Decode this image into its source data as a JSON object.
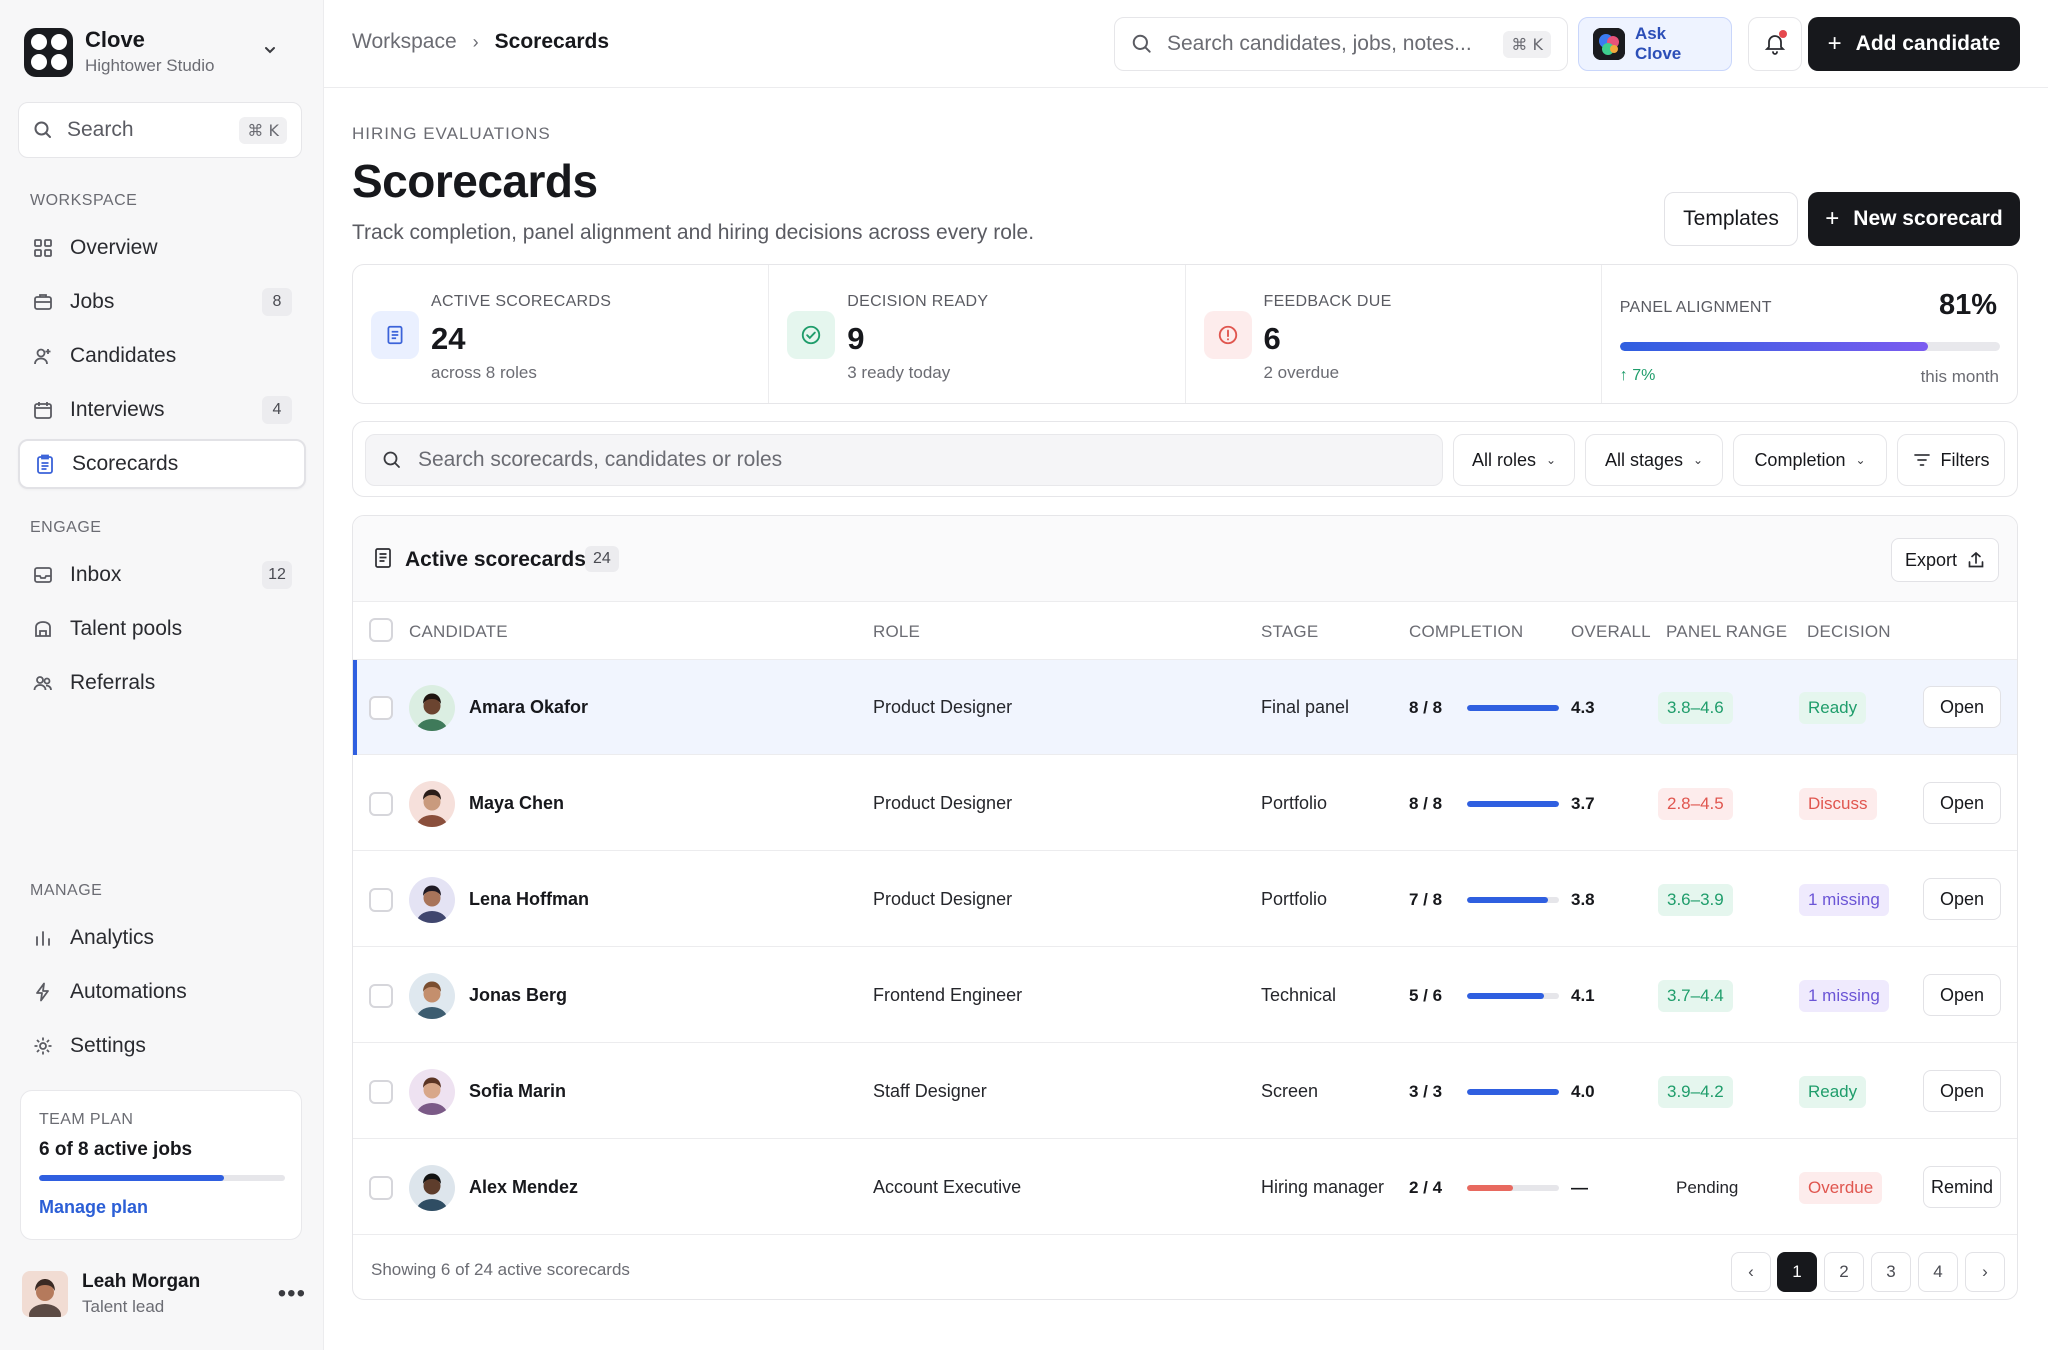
{
  "brand": {
    "name": "Clove",
    "workspace": "Hightower Studio"
  },
  "sidebar": {
    "search_placeholder": "Search",
    "search_shortcut": "⌘ K",
    "sections": {
      "workspace": "WORKSPACE",
      "engage": "ENGAGE",
      "manage": "MANAGE"
    },
    "items": [
      {
        "label": "Overview",
        "icon": "grid-icon",
        "count": null
      },
      {
        "label": "Jobs",
        "icon": "briefcase-icon",
        "count": "8"
      },
      {
        "label": "Candidates",
        "icon": "user-plus-icon",
        "count": null
      },
      {
        "label": "Interviews",
        "icon": "calendar-icon",
        "count": "4"
      },
      {
        "label": "Scorecards",
        "icon": "clipboard-icon",
        "count": null,
        "active": true
      },
      {
        "label": "Inbox",
        "icon": "inbox-icon",
        "count": "12"
      },
      {
        "label": "Talent pools",
        "icon": "bank-icon",
        "count": null
      },
      {
        "label": "Referrals",
        "icon": "users-icon",
        "count": null
      },
      {
        "label": "Analytics",
        "icon": "bar-chart-icon",
        "count": null
      },
      {
        "label": "Automations",
        "icon": "bolt-icon",
        "count": null
      },
      {
        "label": "Settings",
        "icon": "gear-icon",
        "count": null
      }
    ],
    "plan": {
      "label": "TEAM PLAN",
      "value": "6 of 8 active jobs",
      "progress": 0.75,
      "link": "Manage plan"
    },
    "user": {
      "name": "Leah Morgan",
      "role": "Talent lead"
    }
  },
  "topbar": {
    "breadcrumb": [
      "Workspace",
      "Scorecards"
    ],
    "search_placeholder": "Search candidates, jobs, notes...",
    "search_shortcut": "⌘ K",
    "ask_label": "Ask Clove",
    "add_label": "Add candidate"
  },
  "header": {
    "kicker": "HIRING EVALUATIONS",
    "title": "Scorecards",
    "subtitle": "Track completion, panel alignment and hiring decisions across every role.",
    "templates_label": "Templates",
    "new_label": "New scorecard"
  },
  "stats": [
    {
      "label": "ACTIVE SCORECARDS",
      "value": "24",
      "sub": "across 8 roles"
    },
    {
      "label": "DECISION READY",
      "value": "9",
      "sub": "3 ready today"
    },
    {
      "label": "FEEDBACK DUE",
      "value": "6",
      "sub": "2 overdue"
    }
  ],
  "alignment": {
    "label": "PANEL ALIGNMENT",
    "value": "81%",
    "progress": 0.81,
    "delta": "↑ 7%",
    "period": "this month"
  },
  "filters": {
    "search_placeholder": "Search scorecards, candidates or roles",
    "roles": "All roles",
    "stages": "All stages",
    "completion": "Completion",
    "more": "Filters"
  },
  "table": {
    "title": "Active scorecards",
    "count": "24",
    "export_label": "Export",
    "columns": {
      "candidate": "CANDIDATE",
      "role": "ROLE",
      "stage": "STAGE",
      "completion": "COMPLETION",
      "overall": "OVERALL",
      "range": "PANEL RANGE",
      "decision": "DECISION"
    },
    "rows": [
      {
        "name": "Amara Okafor",
        "role": "Product Designer",
        "stage": "Final panel",
        "completion": "8 / 8",
        "progress": 1.0,
        "overall": "4.3",
        "range": "3.8–4.6",
        "range_tone": "green",
        "decision": "Ready",
        "decision_tone": "green",
        "action": "Open",
        "selected": true
      },
      {
        "name": "Maya Chen",
        "role": "Product Designer",
        "stage": "Portfolio",
        "completion": "8 / 8",
        "progress": 1.0,
        "overall": "3.7",
        "range": "2.8–4.5",
        "range_tone": "red",
        "decision": "Discuss",
        "decision_tone": "red",
        "action": "Open"
      },
      {
        "name": "Lena Hoffman",
        "role": "Product Designer",
        "stage": "Portfolio",
        "completion": "7 / 8",
        "progress": 0.875,
        "overall": "3.8",
        "range": "3.6–3.9",
        "range_tone": "green",
        "decision": "1 missing",
        "decision_tone": "purple",
        "action": "Open"
      },
      {
        "name": "Jonas Berg",
        "role": "Frontend Engineer",
        "stage": "Technical",
        "completion": "5 / 6",
        "progress": 0.833,
        "overall": "4.1",
        "range": "3.7–4.4",
        "range_tone": "green",
        "decision": "1 missing",
        "decision_tone": "purple",
        "action": "Open"
      },
      {
        "name": "Sofia Marin",
        "role": "Staff Designer",
        "stage": "Screen",
        "completion": "3 / 3",
        "progress": 1.0,
        "overall": "4.0",
        "range": "3.9–4.2",
        "range_tone": "green",
        "decision": "Ready",
        "decision_tone": "green",
        "action": "Open"
      },
      {
        "name": "Alex Mendez",
        "role": "Account Executive",
        "stage": "Hiring manager",
        "completion": "2 / 4",
        "progress": 0.5,
        "overall": "—",
        "range": "Pending",
        "range_tone": "plain",
        "decision": "Overdue",
        "decision_tone": "red",
        "action": "Remind"
      }
    ],
    "footer": "Showing 6 of 24 active scorecards",
    "pages": [
      "1",
      "2",
      "3",
      "4"
    ],
    "current_page": "1",
    "prev": "‹",
    "next": "›"
  },
  "colors": {
    "accent": "#2f5fe0",
    "green_bg": "#e5f6ee",
    "green_fg": "#1f9d6b",
    "red_bg": "#fdecec",
    "red_fg": "#e0564f",
    "purple_bg": "#efeafd",
    "purple_fg": "#6b55d6"
  }
}
